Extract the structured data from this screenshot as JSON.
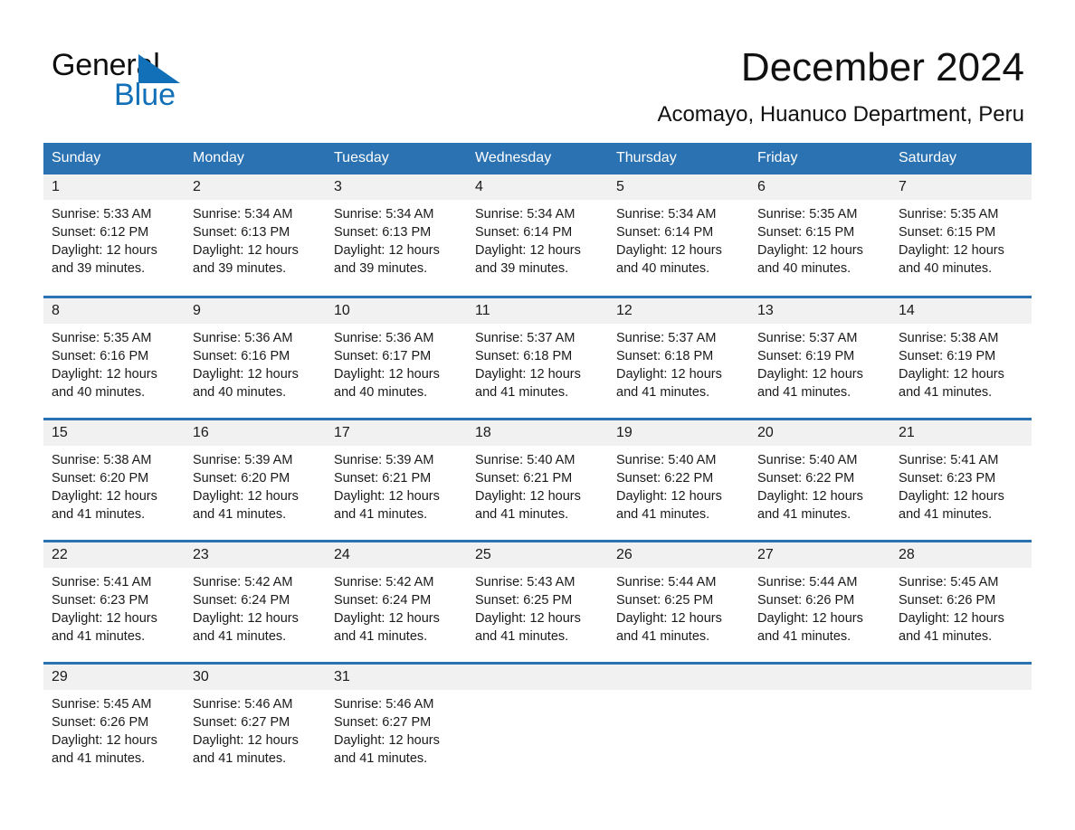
{
  "brand": {
    "name_part1": "General",
    "name_part2": "Blue",
    "triangle_color": "#1270b8"
  },
  "header": {
    "title": "December 2024",
    "subtitle": "Acomayo, Huanuco Department, Peru"
  },
  "colors": {
    "header_blue": "#2b72b2",
    "daynum_band": "#f1f1f1",
    "text": "#1a1a1a"
  },
  "calendar": {
    "weekday_headers": [
      "Sunday",
      "Monday",
      "Tuesday",
      "Wednesday",
      "Thursday",
      "Friday",
      "Saturday"
    ],
    "weeks": [
      [
        {
          "day": "1",
          "sunrise": "Sunrise: 5:33 AM",
          "sunset": "Sunset: 6:12 PM",
          "daylight1": "Daylight: 12 hours",
          "daylight2": "and 39 minutes."
        },
        {
          "day": "2",
          "sunrise": "Sunrise: 5:34 AM",
          "sunset": "Sunset: 6:13 PM",
          "daylight1": "Daylight: 12 hours",
          "daylight2": "and 39 minutes."
        },
        {
          "day": "3",
          "sunrise": "Sunrise: 5:34 AM",
          "sunset": "Sunset: 6:13 PM",
          "daylight1": "Daylight: 12 hours",
          "daylight2": "and 39 minutes."
        },
        {
          "day": "4",
          "sunrise": "Sunrise: 5:34 AM",
          "sunset": "Sunset: 6:14 PM",
          "daylight1": "Daylight: 12 hours",
          "daylight2": "and 39 minutes."
        },
        {
          "day": "5",
          "sunrise": "Sunrise: 5:34 AM",
          "sunset": "Sunset: 6:14 PM",
          "daylight1": "Daylight: 12 hours",
          "daylight2": "and 40 minutes."
        },
        {
          "day": "6",
          "sunrise": "Sunrise: 5:35 AM",
          "sunset": "Sunset: 6:15 PM",
          "daylight1": "Daylight: 12 hours",
          "daylight2": "and 40 minutes."
        },
        {
          "day": "7",
          "sunrise": "Sunrise: 5:35 AM",
          "sunset": "Sunset: 6:15 PM",
          "daylight1": "Daylight: 12 hours",
          "daylight2": "and 40 minutes."
        }
      ],
      [
        {
          "day": "8",
          "sunrise": "Sunrise: 5:35 AM",
          "sunset": "Sunset: 6:16 PM",
          "daylight1": "Daylight: 12 hours",
          "daylight2": "and 40 minutes."
        },
        {
          "day": "9",
          "sunrise": "Sunrise: 5:36 AM",
          "sunset": "Sunset: 6:16 PM",
          "daylight1": "Daylight: 12 hours",
          "daylight2": "and 40 minutes."
        },
        {
          "day": "10",
          "sunrise": "Sunrise: 5:36 AM",
          "sunset": "Sunset: 6:17 PM",
          "daylight1": "Daylight: 12 hours",
          "daylight2": "and 40 minutes."
        },
        {
          "day": "11",
          "sunrise": "Sunrise: 5:37 AM",
          "sunset": "Sunset: 6:18 PM",
          "daylight1": "Daylight: 12 hours",
          "daylight2": "and 41 minutes."
        },
        {
          "day": "12",
          "sunrise": "Sunrise: 5:37 AM",
          "sunset": "Sunset: 6:18 PM",
          "daylight1": "Daylight: 12 hours",
          "daylight2": "and 41 minutes."
        },
        {
          "day": "13",
          "sunrise": "Sunrise: 5:37 AM",
          "sunset": "Sunset: 6:19 PM",
          "daylight1": "Daylight: 12 hours",
          "daylight2": "and 41 minutes."
        },
        {
          "day": "14",
          "sunrise": "Sunrise: 5:38 AM",
          "sunset": "Sunset: 6:19 PM",
          "daylight1": "Daylight: 12 hours",
          "daylight2": "and 41 minutes."
        }
      ],
      [
        {
          "day": "15",
          "sunrise": "Sunrise: 5:38 AM",
          "sunset": "Sunset: 6:20 PM",
          "daylight1": "Daylight: 12 hours",
          "daylight2": "and 41 minutes."
        },
        {
          "day": "16",
          "sunrise": "Sunrise: 5:39 AM",
          "sunset": "Sunset: 6:20 PM",
          "daylight1": "Daylight: 12 hours",
          "daylight2": "and 41 minutes."
        },
        {
          "day": "17",
          "sunrise": "Sunrise: 5:39 AM",
          "sunset": "Sunset: 6:21 PM",
          "daylight1": "Daylight: 12 hours",
          "daylight2": "and 41 minutes."
        },
        {
          "day": "18",
          "sunrise": "Sunrise: 5:40 AM",
          "sunset": "Sunset: 6:21 PM",
          "daylight1": "Daylight: 12 hours",
          "daylight2": "and 41 minutes."
        },
        {
          "day": "19",
          "sunrise": "Sunrise: 5:40 AM",
          "sunset": "Sunset: 6:22 PM",
          "daylight1": "Daylight: 12 hours",
          "daylight2": "and 41 minutes."
        },
        {
          "day": "20",
          "sunrise": "Sunrise: 5:40 AM",
          "sunset": "Sunset: 6:22 PM",
          "daylight1": "Daylight: 12 hours",
          "daylight2": "and 41 minutes."
        },
        {
          "day": "21",
          "sunrise": "Sunrise: 5:41 AM",
          "sunset": "Sunset: 6:23 PM",
          "daylight1": "Daylight: 12 hours",
          "daylight2": "and 41 minutes."
        }
      ],
      [
        {
          "day": "22",
          "sunrise": "Sunrise: 5:41 AM",
          "sunset": "Sunset: 6:23 PM",
          "daylight1": "Daylight: 12 hours",
          "daylight2": "and 41 minutes."
        },
        {
          "day": "23",
          "sunrise": "Sunrise: 5:42 AM",
          "sunset": "Sunset: 6:24 PM",
          "daylight1": "Daylight: 12 hours",
          "daylight2": "and 41 minutes."
        },
        {
          "day": "24",
          "sunrise": "Sunrise: 5:42 AM",
          "sunset": "Sunset: 6:24 PM",
          "daylight1": "Daylight: 12 hours",
          "daylight2": "and 41 minutes."
        },
        {
          "day": "25",
          "sunrise": "Sunrise: 5:43 AM",
          "sunset": "Sunset: 6:25 PM",
          "daylight1": "Daylight: 12 hours",
          "daylight2": "and 41 minutes."
        },
        {
          "day": "26",
          "sunrise": "Sunrise: 5:44 AM",
          "sunset": "Sunset: 6:25 PM",
          "daylight1": "Daylight: 12 hours",
          "daylight2": "and 41 minutes."
        },
        {
          "day": "27",
          "sunrise": "Sunrise: 5:44 AM",
          "sunset": "Sunset: 6:26 PM",
          "daylight1": "Daylight: 12 hours",
          "daylight2": "and 41 minutes."
        },
        {
          "day": "28",
          "sunrise": "Sunrise: 5:45 AM",
          "sunset": "Sunset: 6:26 PM",
          "daylight1": "Daylight: 12 hours",
          "daylight2": "and 41 minutes."
        }
      ],
      [
        {
          "day": "29",
          "sunrise": "Sunrise: 5:45 AM",
          "sunset": "Sunset: 6:26 PM",
          "daylight1": "Daylight: 12 hours",
          "daylight2": "and 41 minutes."
        },
        {
          "day": "30",
          "sunrise": "Sunrise: 5:46 AM",
          "sunset": "Sunset: 6:27 PM",
          "daylight1": "Daylight: 12 hours",
          "daylight2": "and 41 minutes."
        },
        {
          "day": "31",
          "sunrise": "Sunrise: 5:46 AM",
          "sunset": "Sunset: 6:27 PM",
          "daylight1": "Daylight: 12 hours",
          "daylight2": "and 41 minutes."
        },
        {
          "day": "",
          "sunrise": "",
          "sunset": "",
          "daylight1": "",
          "daylight2": ""
        },
        {
          "day": "",
          "sunrise": "",
          "sunset": "",
          "daylight1": "",
          "daylight2": ""
        },
        {
          "day": "",
          "sunrise": "",
          "sunset": "",
          "daylight1": "",
          "daylight2": ""
        },
        {
          "day": "",
          "sunrise": "",
          "sunset": "",
          "daylight1": "",
          "daylight2": ""
        }
      ]
    ]
  }
}
